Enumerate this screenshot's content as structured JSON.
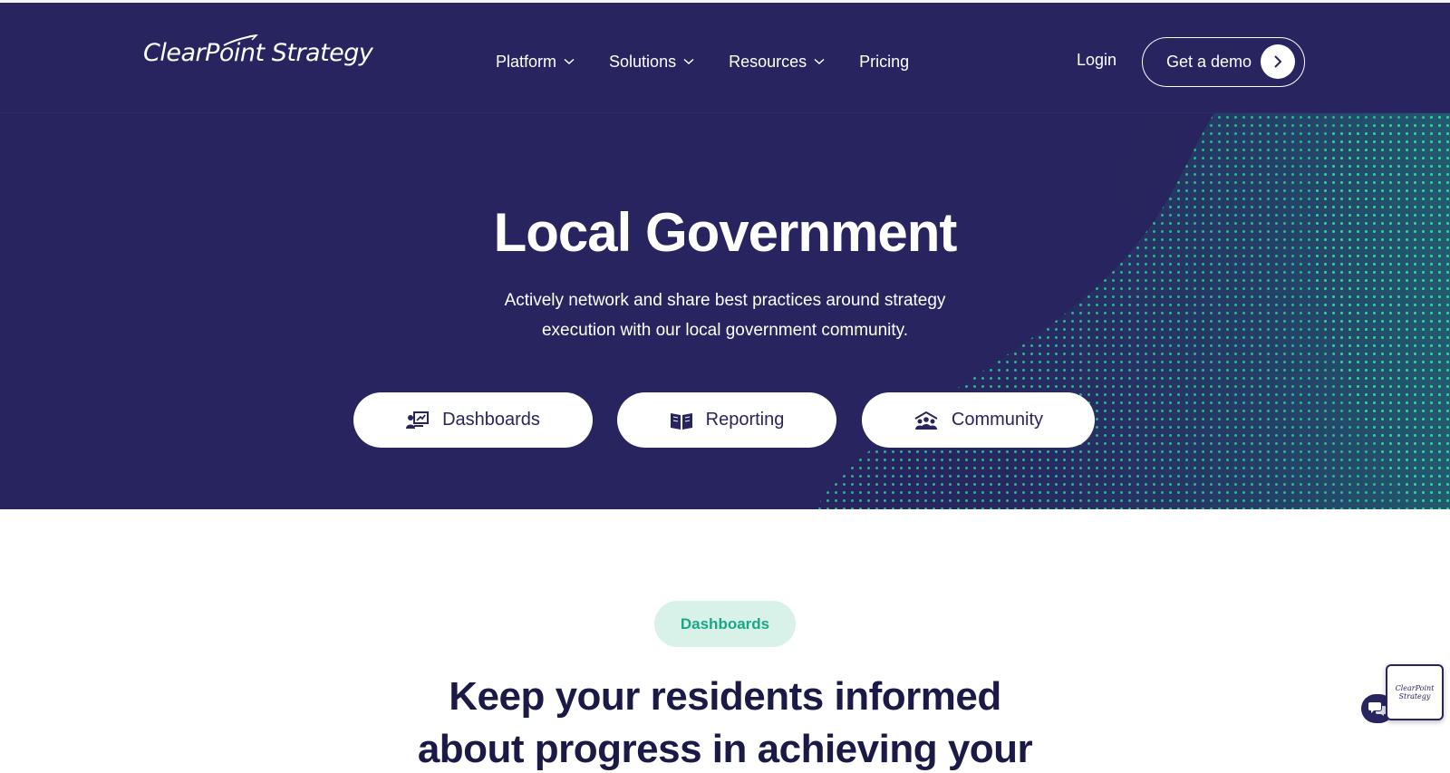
{
  "header": {
    "logo_text": "ClearPoint Strategy",
    "nav": [
      {
        "label": "Platform",
        "has_dropdown": true
      },
      {
        "label": "Solutions",
        "has_dropdown": true
      },
      {
        "label": "Resources",
        "has_dropdown": true
      },
      {
        "label": "Pricing",
        "has_dropdown": false
      }
    ],
    "login_label": "Login",
    "demo_label": "Get a demo"
  },
  "hero": {
    "title": "Local Government",
    "subtitle_line1": "Actively network and share best practices around strategy",
    "subtitle_line2": "execution with our local government community.",
    "buttons": [
      {
        "label": "Dashboards",
        "icon": "dashboard-presentation-icon"
      },
      {
        "label": "Reporting",
        "icon": "open-book-icon"
      },
      {
        "label": "Community",
        "icon": "community-people-icon"
      }
    ]
  },
  "section": {
    "tag": "Dashboards",
    "heading_line1": "Keep your residents informed",
    "heading_line2": "about progress in achieving your"
  },
  "chat_widget": {
    "card_text_line1": "ClearPoint",
    "card_text_line2": "Strategy",
    "icon": "chat-bubbles-icon"
  },
  "colors": {
    "navy": "#27245f",
    "accent_green": "#1aa787",
    "tag_bg": "#d8f2ea"
  }
}
